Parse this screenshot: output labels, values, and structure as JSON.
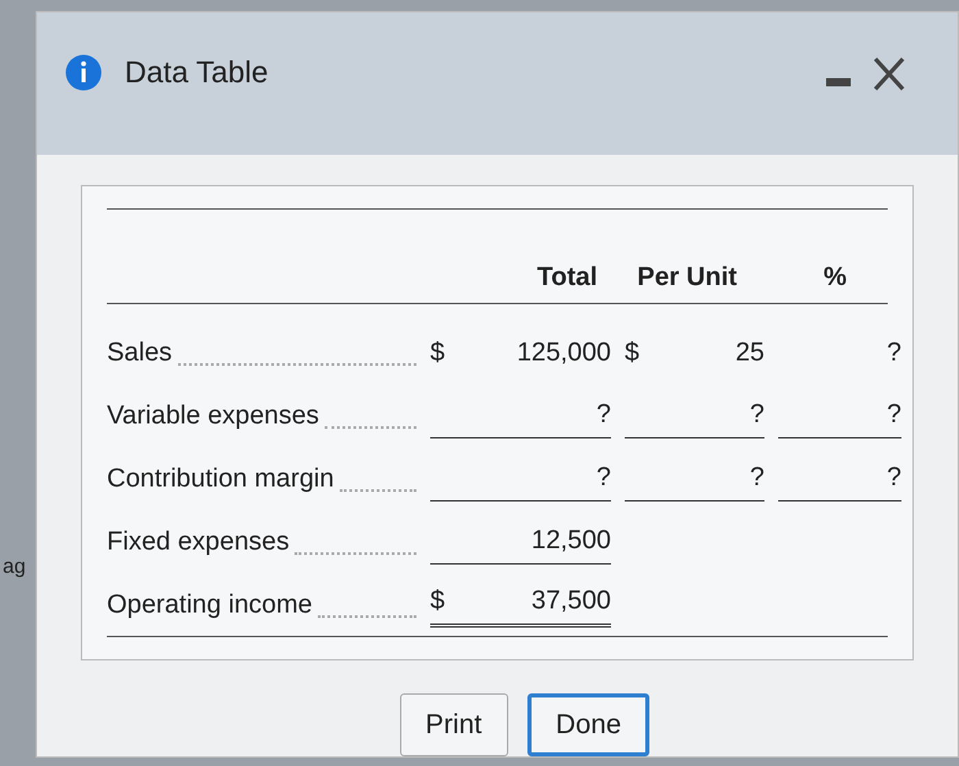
{
  "background_text": "ag",
  "window": {
    "title": "Data Table"
  },
  "table": {
    "columns": [
      "Total",
      "Per Unit",
      "%"
    ],
    "rows": [
      {
        "label": "Sales",
        "total_prefix": "$",
        "total": "125,000",
        "unit_prefix": "$",
        "per_unit": "25",
        "percent": "?",
        "underlined": false,
        "double_underlined": false
      },
      {
        "label": "Variable expenses",
        "total": "?",
        "per_unit": "?",
        "percent": "?",
        "underlined": true,
        "double_underlined": false
      },
      {
        "label": "Contribution margin",
        "total": "?",
        "per_unit": "?",
        "percent": "?",
        "underlined": true,
        "double_underlined": false
      },
      {
        "label": "Fixed expenses",
        "total": "12,500",
        "underlined": true,
        "double_underlined": false
      },
      {
        "label": "Operating income",
        "total_prefix": "$",
        "total": "37,500",
        "underlined": false,
        "double_underlined": true
      }
    ]
  },
  "buttons": [
    {
      "label": "Print",
      "selected": false
    },
    {
      "label": "Done",
      "selected": true
    }
  ]
}
